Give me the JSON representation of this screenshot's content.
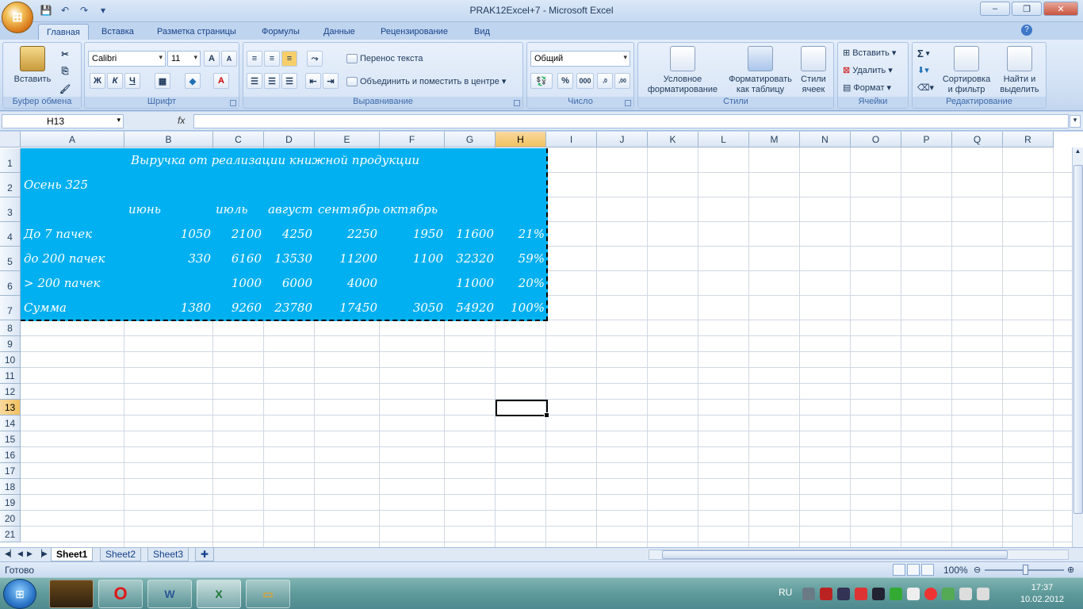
{
  "window": {
    "title": "PRAK12Excel+7 - Microsoft Excel",
    "minimize": "–",
    "restore": "❐",
    "close": "✕"
  },
  "qat": {
    "save": "💾",
    "undo": "↶",
    "redo": "↷",
    "more": "▾"
  },
  "ribbon_tabs": [
    "Главная",
    "Вставка",
    "Разметка страницы",
    "Формулы",
    "Данные",
    "Рецензирование",
    "Вид"
  ],
  "clipboard": {
    "paste": "Вставить",
    "group": "Буфер обмена"
  },
  "font": {
    "name": "Calibri",
    "size": "11",
    "bold": "Ж",
    "italic": "К",
    "underline": "Ч",
    "grow": "A",
    "shrink": "A",
    "fontcolor": "A",
    "group": "Шрифт"
  },
  "alignment": {
    "wrap": "Перенос текста",
    "merge": "Объединить и поместить в центре",
    "group": "Выравнивание"
  },
  "number": {
    "format": "Общий",
    "percent": "%",
    "thousands": "000",
    "inc": ",0 ,00",
    "dec": ",00 ,0",
    "group": "Число"
  },
  "styles": {
    "conditional": "Условное форматирование",
    "astable": "Форматировать как таблицу",
    "cellstyles": "Стили ячеек",
    "group": "Стили"
  },
  "cells": {
    "insert": "Вставить",
    "delete": "Удалить",
    "format": "Формат",
    "group": "Ячейки"
  },
  "editing": {
    "sum": "Σ",
    "sort": "Сортировка и фильтр",
    "find": "Найти и выделить",
    "group": "Редактирование"
  },
  "formula_bar": {
    "namebox": "H13",
    "fx": "fx",
    "value": ""
  },
  "columns": [
    "A",
    "B",
    "C",
    "D",
    "E",
    "F",
    "G",
    "H",
    "I",
    "J",
    "K",
    "L",
    "M",
    "N",
    "O",
    "P",
    "Q",
    "R"
  ],
  "selected_column": "H",
  "rows": [
    "1",
    "2",
    "3",
    "4",
    "5",
    "6",
    "7",
    "8",
    "9",
    "10",
    "11",
    "12",
    "13",
    "14",
    "15",
    "16",
    "17",
    "18",
    "19",
    "20",
    "21"
  ],
  "selected_row": "13",
  "sheet": {
    "title": "Выручка от реализации книжной продукции",
    "subtitle": "Осень 325",
    "months": [
      "июнь",
      "июль",
      "август",
      "сентябрь",
      "октябрь"
    ],
    "table": [
      {
        "label": "До 7 пачек",
        "b": "1050",
        "c": "2100",
        "d": "4250",
        "e": "2250",
        "f": "1950",
        "g": "11600",
        "h": "21%"
      },
      {
        "label": "до 200 пачек",
        "b": "330",
        "c": "6160",
        "d": "13530",
        "e": "11200",
        "f": "1100",
        "g": "32320",
        "h": "59%"
      },
      {
        "label": "> 200 пачек",
        "b": "",
        "c": "1000",
        "d": "6000",
        "e": "4000",
        "f": "",
        "g": "11000",
        "h": "20%"
      },
      {
        "label": "Сумма",
        "b": "1380",
        "c": "9260",
        "d": "23780",
        "e": "17450",
        "f": "3050",
        "g": "54920",
        "h": "100%"
      }
    ]
  },
  "sheet_tabs": [
    "Sheet1",
    "Sheet2",
    "Sheet3"
  ],
  "status": {
    "ready": "Готово",
    "zoom": "100%"
  },
  "taskbar": {
    "lang": "RU",
    "time": "17:37",
    "date": "10.02.2012"
  },
  "colors": {
    "fill": "#00b0f0",
    "excel_green": "#1f7a3a",
    "word_blue": "#2b5797"
  }
}
